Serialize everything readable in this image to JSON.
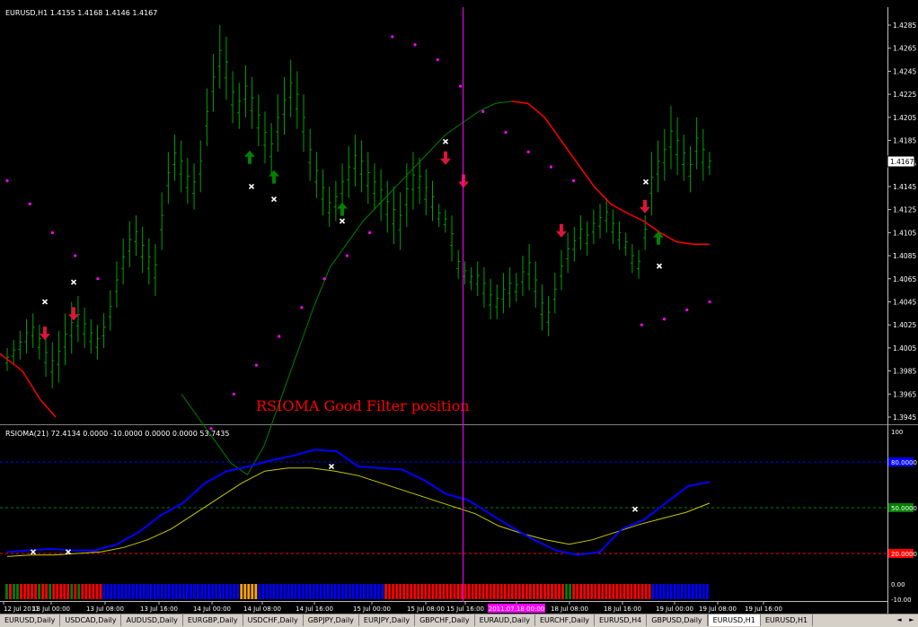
{
  "window": {
    "main_title": "EURUSD,H1  1.4155 1.4168 1.4146 1.4167",
    "sub_title": "RSIOMA(21) 72.4134 0.0000 -10.0000 0.0000 0.0000 53.7435",
    "annotation": "RSIOMA Good Filter position",
    "current_price": "1.4167",
    "crosshair_label": "2011.07.18 00:00"
  },
  "tabs": [
    {
      "label": "EURUSD,Daily"
    },
    {
      "label": "USDCAD,Daily"
    },
    {
      "label": "AUDUSD,Daily"
    },
    {
      "label": "EURGBP,Daily"
    },
    {
      "label": "USDCHF,Daily"
    },
    {
      "label": "GBPJPY,Daily"
    },
    {
      "label": "EURJPY,Daily"
    },
    {
      "label": "GBPCHF,Daily"
    },
    {
      "label": "EURAUD,Daily"
    },
    {
      "label": "EURCHF,Daily"
    },
    {
      "label": "EURUSD,H4"
    },
    {
      "label": "GBPUSD,Daily"
    },
    {
      "label": "EURUSD,H1",
      "active": true
    },
    {
      "label": "EURUSD,H1"
    }
  ],
  "colors": {
    "background": "#000000",
    "bars": "#00a000",
    "ma_up": "#008000",
    "ma_down": "#ff0000",
    "sar": "#ff00ff",
    "arrow_up": "#008000",
    "arrow_down": "#dc143c",
    "rsioma": "#0000ff",
    "signal": "#c8c800",
    "cross": "#ffffff",
    "histo_red": "#ff0000",
    "histo_green": "#008000",
    "histo_blue": "#0000ff",
    "histo_orange": "#ffa500",
    "text": "#ffffff",
    "annotation": "#ff0000"
  },
  "chart_data": [
    {
      "type": "line",
      "title": "EURUSD,H1  1.4155 1.4168 1.4146 1.4167",
      "ylim": [
        1.3935,
        1.4295
      ],
      "y_ticks": [
        "1.4285",
        "1.4265",
        "1.4245",
        "1.4225",
        "1.4205",
        "1.4185",
        "1.4165",
        "1.4145",
        "1.4125",
        "1.4105",
        "1.4085",
        "1.4065",
        "1.4045",
        "1.4025",
        "1.4005",
        "1.3985",
        "1.3965",
        "1.3945"
      ],
      "x_ticks": [
        "12 Jul 2011",
        "13 Jul 00:00",
        "13 Jul 08:00",
        "13 Jul 16:00",
        "14 Jul 00:00",
        "14 Jul 08:00",
        "14 Jul 16:00",
        "15 Jul 00:00",
        "15 Jul 08:00",
        "15 Jul 16:00",
        "2011.07.18 00:00",
        "18 Jul 08:00",
        "18 Jul 16:00",
        "19 Jul 00:00",
        "19 Jul 08:00",
        "19 Jul 16:00"
      ],
      "last_price": 1.4167,
      "series": [
        {
          "name": "EURUSD,H1",
          "values": [
            [
              1.4005,
              1.3985
            ],
            [
              1.4012,
              1.399
            ],
            [
              1.402,
              1.3995
            ],
            [
              1.403,
              1.4
            ],
            [
              1.4035,
              1.4005
            ],
            [
              1.4025,
              1.3995
            ],
            [
              1.4015,
              1.398
            ],
            [
              1.401,
              1.397
            ],
            [
              1.402,
              1.3975
            ],
            [
              1.4035,
              1.399
            ],
            [
              1.4045,
              1.4
            ],
            [
              1.405,
              1.401
            ],
            [
              1.404,
              1.4005
            ],
            [
              1.403,
              1.4
            ],
            [
              1.4025,
              1.3995
            ],
            [
              1.4035,
              1.4005
            ],
            [
              1.4055,
              1.402
            ],
            [
              1.408,
              1.404
            ],
            [
              1.41,
              1.406
            ],
            [
              1.4115,
              1.4075
            ],
            [
              1.412,
              1.4085
            ],
            [
              1.411,
              1.407
            ],
            [
              1.41,
              1.406
            ],
            [
              1.4095,
              1.405
            ],
            [
              1.414,
              1.409
            ],
            [
              1.4175,
              1.413
            ],
            [
              1.419,
              1.415
            ],
            [
              1.4185,
              1.414
            ],
            [
              1.417,
              1.413
            ],
            [
              1.4165,
              1.4125
            ],
            [
              1.4185,
              1.414
            ],
            [
              1.423,
              1.418
            ],
            [
              1.426,
              1.421
            ],
            [
              1.4285,
              1.423
            ],
            [
              1.4275,
              1.422
            ],
            [
              1.4245,
              1.42
            ],
            [
              1.4235,
              1.4195
            ],
            [
              1.425,
              1.4205
            ],
            [
              1.424,
              1.4195
            ],
            [
              1.4225,
              1.418
            ],
            [
              1.421,
              1.4165
            ],
            [
              1.42,
              1.4155
            ],
            [
              1.4225,
              1.4175
            ],
            [
              1.424,
              1.419
            ],
            [
              1.4255,
              1.4205
            ],
            [
              1.4245,
              1.4195
            ],
            [
              1.4225,
              1.4175
            ],
            [
              1.4195,
              1.415
            ],
            [
              1.4175,
              1.4135
            ],
            [
              1.416,
              1.412
            ],
            [
              1.4145,
              1.411
            ],
            [
              1.415,
              1.4115
            ],
            [
              1.4165,
              1.4125
            ],
            [
              1.418,
              1.4135
            ],
            [
              1.419,
              1.4145
            ],
            [
              1.4185,
              1.414
            ],
            [
              1.4175,
              1.413
            ],
            [
              1.4165,
              1.4125
            ],
            [
              1.416,
              1.4115
            ],
            [
              1.415,
              1.4105
            ],
            [
              1.4145,
              1.4095
            ],
            [
              1.414,
              1.409
            ],
            [
              1.4165,
              1.411
            ],
            [
              1.4175,
              1.4125
            ],
            [
              1.417,
              1.413
            ],
            [
              1.416,
              1.412
            ],
            [
              1.415,
              1.4115
            ],
            [
              1.413,
              1.411
            ],
            [
              1.4125,
              1.4105
            ],
            [
              1.412,
              1.408
            ],
            [
              1.409,
              1.4065
            ],
            [
              1.408,
              1.406
            ],
            [
              1.4075,
              1.4055
            ],
            [
              1.408,
              1.405
            ],
            [
              1.4075,
              1.404
            ],
            [
              1.4065,
              1.403
            ],
            [
              1.406,
              1.403
            ],
            [
              1.407,
              1.4035
            ],
            [
              1.4075,
              1.404
            ],
            [
              1.407,
              1.4045
            ],
            [
              1.4085,
              1.405
            ],
            [
              1.4095,
              1.4055
            ],
            [
              1.408,
              1.404
            ],
            [
              1.406,
              1.402
            ],
            [
              1.405,
              1.4015
            ],
            [
              1.407,
              1.4035
            ],
            [
              1.409,
              1.4055
            ],
            [
              1.4105,
              1.407
            ],
            [
              1.411,
              1.408
            ],
            [
              1.412,
              1.409
            ],
            [
              1.4115,
              1.4085
            ],
            [
              1.4125,
              1.4095
            ],
            [
              1.413,
              1.41
            ],
            [
              1.4135,
              1.4105
            ],
            [
              1.4125,
              1.4095
            ],
            [
              1.4115,
              1.409
            ],
            [
              1.4105,
              1.4085
            ],
            [
              1.4095,
              1.407
            ],
            [
              1.409,
              1.4065
            ],
            [
              1.412,
              1.409
            ],
            [
              1.4175,
              1.412
            ],
            [
              1.4185,
              1.414
            ],
            [
              1.4195,
              1.415
            ],
            [
              1.4215,
              1.416
            ],
            [
              1.4205,
              1.4155
            ],
            [
              1.419,
              1.415
            ],
            [
              1.418,
              1.414
            ],
            [
              1.4205,
              1.416
            ],
            [
              1.4195,
              1.415
            ],
            [
              1.4175,
              1.4155
            ]
          ]
        },
        {
          "name": "MA",
          "values": [
            1.3965,
            1.3945,
            1.3925,
            1.3905,
            1.3895,
            1.392,
            1.396,
            1.4,
            1.404,
            1.4075,
            1.4095,
            1.4115,
            1.413,
            1.4145,
            1.416,
            1.4175,
            1.419,
            1.42,
            1.421,
            1.4217,
            1.4219,
            1.4217,
            1.4205,
            1.4185,
            1.4165,
            1.4145,
            1.413,
            1.4122,
            1.4115,
            1.4105,
            1.4097,
            1.4095,
            1.4095
          ]
        },
        {
          "name": "SAR",
          "values": [
            1.415,
            1.413,
            1.4105,
            1.4085,
            1.4065,
            null,
            null,
            null,
            null,
            1.3935,
            1.3965,
            1.399,
            1.4015,
            1.404,
            1.4065,
            1.4085,
            1.4105,
            1.4275,
            1.4268,
            1.4255,
            1.4232,
            1.421,
            1.4192,
            1.4175,
            1.4162,
            1.415,
            null,
            null,
            1.4025,
            1.403,
            1.4038,
            1.4045
          ]
        }
      ]
    },
    {
      "type": "line",
      "title": "RSIOMA(21) 72.4134 0.0000 -10.0000 0.0000 0.0000 53.7435",
      "ylim": [
        -10,
        100
      ],
      "y_ticks": [
        "100",
        "80.0000",
        "50.0000",
        "20.0000",
        "0.00",
        "-10.00"
      ],
      "levels": [
        {
          "value": 80,
          "color": "#0000ff"
        },
        {
          "value": 50,
          "color": "#008000"
        },
        {
          "value": 20,
          "color": "#ff0000"
        }
      ],
      "series": [
        {
          "name": "RSIOMA",
          "values": [
            21,
            22,
            23,
            22,
            22,
            26,
            34,
            45,
            53,
            66,
            74,
            77,
            81,
            84,
            88,
            87,
            77,
            76,
            75,
            68,
            59,
            55,
            46,
            37,
            29,
            22,
            19,
            21,
            36,
            42,
            53,
            64,
            67
          ]
        },
        {
          "name": "Signal",
          "values": [
            18,
            19,
            19,
            20,
            21,
            24,
            29,
            36,
            46,
            56,
            66,
            74,
            76,
            76,
            74,
            71,
            66,
            61,
            56,
            51,
            46,
            38,
            33,
            29,
            26,
            29,
            34,
            39,
            43,
            47,
            53
          ]
        }
      ],
      "histogram": [
        "green",
        "red",
        "green",
        "green",
        "red",
        "red",
        "red",
        "red",
        "red",
        "green",
        "red",
        "red",
        "green",
        "red",
        "red",
        "red",
        "red",
        "red",
        "green",
        "red",
        "green",
        "red",
        "red",
        "red",
        "red",
        "red",
        "red",
        "blue",
        "blue",
        "blue",
        "blue",
        "blue",
        "blue",
        "blue",
        "blue",
        "blue",
        "blue",
        "blue",
        "blue",
        "blue",
        "blue",
        "blue",
        "blue",
        "blue",
        "blue",
        "blue",
        "blue",
        "blue",
        "blue",
        "blue",
        "blue",
        "blue",
        "blue",
        "blue",
        "blue",
        "blue",
        "blue",
        "blue",
        "blue",
        "blue",
        "blue",
        "blue",
        "blue",
        "blue",
        "blue",
        "orange",
        "orange",
        "orange",
        "orange",
        "orange",
        "blue",
        "blue",
        "blue",
        "blue",
        "blue",
        "blue",
        "blue",
        "blue",
        "blue",
        "blue",
        "blue",
        "blue",
        "blue",
        "blue",
        "blue",
        "blue",
        "blue",
        "blue",
        "blue",
        "blue",
        "blue",
        "blue",
        "blue",
        "blue",
        "blue",
        "blue",
        "blue",
        "blue",
        "blue",
        "blue",
        "blue",
        "blue",
        "blue",
        "blue",
        "blue",
        "red",
        "red",
        "red",
        "red",
        "red",
        "red",
        "red",
        "red",
        "red",
        "red",
        "red",
        "red",
        "red",
        "red",
        "red",
        "red",
        "red",
        "red",
        "red",
        "red",
        "red",
        "red",
        "red",
        "red",
        "red",
        "red",
        "red",
        "red",
        "red",
        "red",
        "red",
        "red",
        "red",
        "red",
        "red",
        "red",
        "red",
        "red",
        "red",
        "red",
        "red",
        "red",
        "red",
        "red",
        "red",
        "red",
        "red",
        "red",
        "red",
        "red",
        "green",
        "green",
        "red",
        "red",
        "red",
        "red",
        "red",
        "red",
        "red",
        "red",
        "red",
        "red",
        "red",
        "red",
        "red",
        "red",
        "red",
        "red",
        "red",
        "red",
        "red",
        "red",
        "red",
        "red",
        "blue",
        "blue",
        "blue",
        "blue",
        "blue",
        "blue",
        "blue",
        "blue",
        "blue",
        "blue",
        "blue",
        "blue",
        "blue",
        "blue",
        "blue",
        "blue"
      ]
    }
  ]
}
